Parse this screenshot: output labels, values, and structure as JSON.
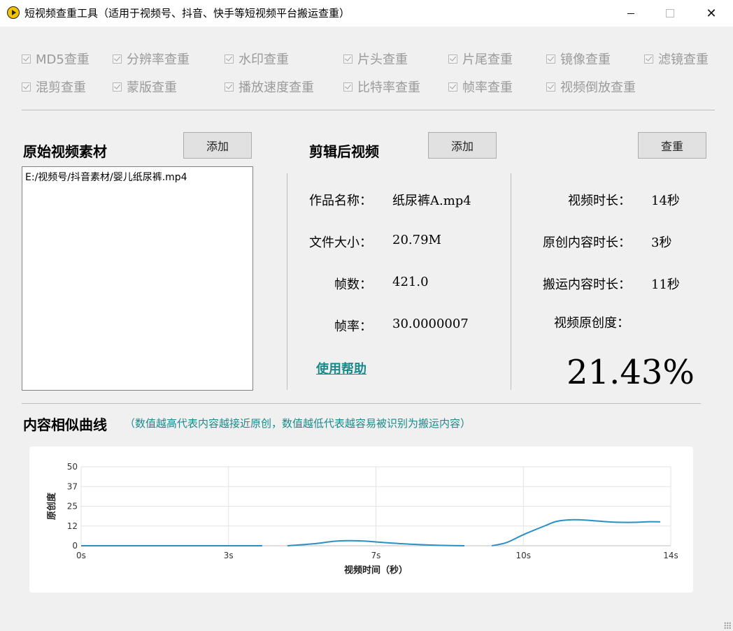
{
  "window": {
    "title": "短视频查重工具（适用于视频号、抖音、快手等短视频平台搬运查重）",
    "controls": {
      "minimize": "minimize-icon",
      "maximize": "maximize-icon",
      "close": "✕"
    }
  },
  "options": [
    {
      "label": "MD5查重",
      "checked": true
    },
    {
      "label": "分辨率查重",
      "checked": true
    },
    {
      "label": "水印查重",
      "checked": true
    },
    {
      "label": "片头查重",
      "checked": true
    },
    {
      "label": "片尾查重",
      "checked": true
    },
    {
      "label": "镜像查重",
      "checked": true
    },
    {
      "label": "滤镜查重",
      "checked": true
    },
    {
      "label": "混剪查重",
      "checked": true
    },
    {
      "label": "蒙版查重",
      "checked": true
    },
    {
      "label": "播放速度查重",
      "checked": true
    },
    {
      "label": "比特率查重",
      "checked": true
    },
    {
      "label": "帧率查重",
      "checked": true
    },
    {
      "label": "视频倒放查重",
      "checked": true
    }
  ],
  "source": {
    "title": "原始视频素材",
    "add_label": "添加",
    "files": [
      "E:/视频号/抖音素材/婴儿纸尿裤.mp4"
    ]
  },
  "edited": {
    "title": "剪辑后视频",
    "add_label": "添加",
    "check_label": "查重",
    "fields": [
      {
        "label": "作品名称：",
        "value": "纸尿裤A.mp4"
      },
      {
        "label": "文件大小：",
        "value": "20.79M"
      },
      {
        "label": "帧数：",
        "value": "421.0"
      },
      {
        "label": "帧率：",
        "value": "30.0000007"
      }
    ],
    "help_link": "使用帮助"
  },
  "stats": {
    "fields": [
      {
        "label": "视频时长：",
        "value": "14秒"
      },
      {
        "label": "原创内容时长：",
        "value": "3秒"
      },
      {
        "label": "搬运内容时长：",
        "value": "11秒"
      }
    ],
    "originality_label": "视频原创度：",
    "originality_value": "21.43%"
  },
  "curve": {
    "title": "内容相似曲线",
    "subtitle": "（数值越高代表内容越接近原创，数值越低代表越容易被识别为搬运内容）"
  },
  "chart_data": {
    "type": "line",
    "title": "",
    "xlabel": "视频时间（秒）",
    "ylabel": "原创度",
    "xlim": [
      0,
      14
    ],
    "ylim": [
      0,
      50
    ],
    "xticks": [
      0,
      3.5,
      7,
      10.5,
      14
    ],
    "xtick_labels": [
      "0s",
      "3s",
      "7s",
      "10s",
      "14s"
    ],
    "yticks": [
      0,
      12.5,
      25,
      37.5,
      50
    ],
    "ytick_labels": [
      "0",
      "12",
      "25",
      "37",
      "50"
    ],
    "grid": true,
    "colors": {
      "line": "#2b8fc6"
    },
    "series": [
      {
        "segments": [
          [
            [
              0,
              0
            ],
            [
              1,
              0
            ],
            [
              2,
              0
            ],
            [
              3,
              0
            ],
            [
              4.3,
              0
            ]
          ],
          [
            [
              4.9,
              0
            ],
            [
              5.5,
              1.2
            ],
            [
              6,
              2.8
            ],
            [
              6.3,
              3.2
            ],
            [
              6.7,
              3
            ],
            [
              7.2,
              2
            ],
            [
              7.8,
              1
            ],
            [
              8.5,
              0.3
            ],
            [
              9.1,
              0
            ]
          ],
          [
            [
              9.75,
              0
            ],
            [
              10.1,
              2
            ],
            [
              10.5,
              7
            ],
            [
              11,
              12.5
            ],
            [
              11.3,
              15.5
            ],
            [
              11.7,
              16.5
            ],
            [
              12.1,
              16
            ],
            [
              12.6,
              15
            ],
            [
              13.1,
              14.8
            ],
            [
              13.5,
              15.2
            ],
            [
              13.75,
              15.1
            ]
          ]
        ]
      }
    ]
  }
}
